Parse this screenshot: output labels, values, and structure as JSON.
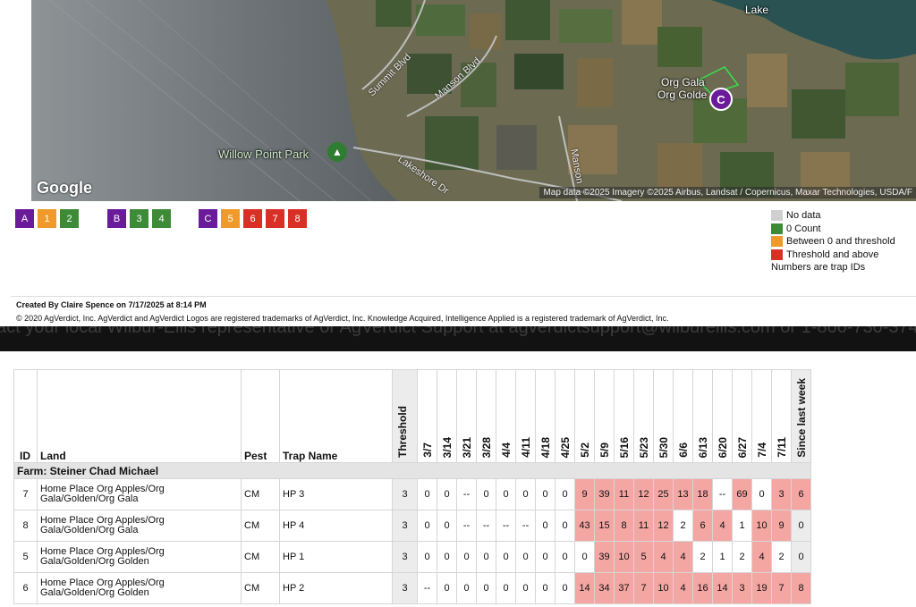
{
  "map": {
    "labels": {
      "lake": "Lake",
      "summit": "Summit Blvd",
      "manson_blvd": "Manson Blvd",
      "manson": "Manson",
      "lakeshore": "Lakeshore Dr",
      "park": "Willow Point Park",
      "org_gala": "Org Gala",
      "org_golden": "Org Golde"
    },
    "marker_letter": "C",
    "google": "Google",
    "attribution": "Map data ©2025 Imagery ©2025 Airbus, Landsat / Copernicus, Maxar Technologies, USDA/F"
  },
  "trap_groups": [
    {
      "site": "A",
      "traps": [
        {
          "id": "1",
          "status": "orange"
        },
        {
          "id": "2",
          "status": "green"
        }
      ]
    },
    {
      "site": "B",
      "traps": [
        {
          "id": "3",
          "status": "green"
        },
        {
          "id": "4",
          "status": "green"
        }
      ]
    },
    {
      "site": "C",
      "traps": [
        {
          "id": "5",
          "status": "orange"
        },
        {
          "id": "6",
          "status": "red"
        },
        {
          "id": "7",
          "status": "red"
        },
        {
          "id": "8",
          "status": "red"
        }
      ]
    }
  ],
  "legend": {
    "no_data": "No data",
    "zero": "0 Count",
    "between": "Between 0 and threshold",
    "above": "Threshold and above",
    "note": "Numbers are trap IDs",
    "colors": {
      "no_data": "#cfcfcf",
      "zero": "#3d8b37",
      "between": "#ef9a2a",
      "above": "#d93025"
    }
  },
  "footer": {
    "created": "Created By Claire Spence on 7/17/2025 at 8:14 PM",
    "copyright": "© 2020 AgVerdict, Inc. AgVerdict and AgVerdict Logos are registered trademarks of AgVerdict, Inc. Knowledge Acquired, Intelligence Applied is a registered trademark of AgVerdict, Inc."
  },
  "background_text": "act your local Wilbur-Ellis representative or AgVerdict Support at agverdictsupport@wilburellis.com or 1-866-730-3749.",
  "table": {
    "headers": {
      "id": "ID",
      "land": "Land",
      "pest": "Pest",
      "trap": "Trap Name",
      "threshold": "Threshold",
      "since": "Since last week"
    },
    "dates": [
      "3/7",
      "3/14",
      "3/21",
      "3/28",
      "4/4",
      "4/11",
      "4/18",
      "4/25",
      "5/2",
      "5/9",
      "5/16",
      "5/23",
      "5/30",
      "6/6",
      "6/13",
      "6/20",
      "6/27",
      "7/4",
      "7/11"
    ],
    "farm": "Farm: Steiner Chad Michael",
    "rows": [
      {
        "id": "7",
        "land": "Home Place Org Apples/Org Gala/Golden/Org Gala",
        "pest": "CM",
        "trap": "HP 3",
        "threshold": "3",
        "counts": [
          "0",
          "0",
          "--",
          "0",
          "0",
          "0",
          "0",
          "0",
          "9",
          "39",
          "11",
          "12",
          "25",
          "13",
          "18",
          "--",
          "69",
          "0",
          "3"
        ],
        "since": "6"
      },
      {
        "id": "8",
        "land": "Home Place Org Apples/Org Gala/Golden/Org Gala",
        "pest": "CM",
        "trap": "HP 4",
        "threshold": "3",
        "counts": [
          "0",
          "0",
          "--",
          "--",
          "--",
          "--",
          "0",
          "0",
          "43",
          "15",
          "8",
          "11",
          "12",
          "2",
          "6",
          "4",
          "1",
          "10",
          "9"
        ],
        "since": "0"
      },
      {
        "id": "5",
        "land": "Home Place Org Apples/Org Gala/Golden/Org Golden",
        "pest": "CM",
        "trap": "HP 1",
        "threshold": "3",
        "counts": [
          "0",
          "0",
          "0",
          "0",
          "0",
          "0",
          "0",
          "0",
          "0",
          "39",
          "10",
          "5",
          "4",
          "4",
          "2",
          "1",
          "2",
          "4",
          "2"
        ],
        "since": "0"
      },
      {
        "id": "6",
        "land": "Home Place Org Apples/Org Gala/Golden/Org Golden",
        "pest": "CM",
        "trap": "HP 2",
        "threshold": "3",
        "counts": [
          "--",
          "0",
          "0",
          "0",
          "0",
          "0",
          "0",
          "0",
          "14",
          "34",
          "37",
          "7",
          "10",
          "4",
          "16",
          "14",
          "3",
          "19",
          "7"
        ],
        "since": "8"
      }
    ]
  }
}
